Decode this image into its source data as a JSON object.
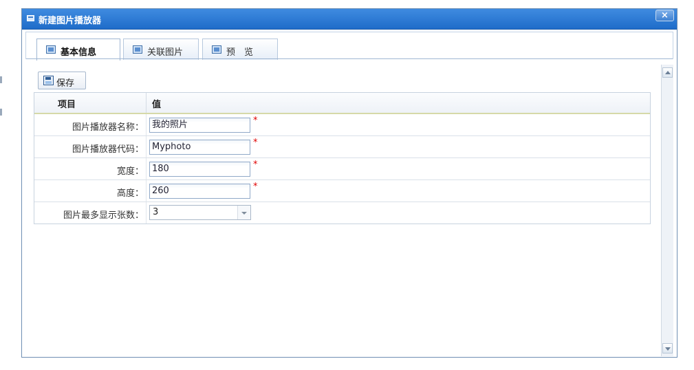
{
  "window": {
    "title": "新建图片播放器",
    "close_label": "×"
  },
  "tabs": [
    {
      "label": "基本信息",
      "active": true
    },
    {
      "label": "关联图片",
      "active": false
    },
    {
      "label": "预　览",
      "active": false
    }
  ],
  "toolbar": {
    "save_label": "保存"
  },
  "grid": {
    "headers": {
      "item": "项目",
      "value": "值"
    },
    "rows": [
      {
        "label": "图片播放器名称：",
        "value": "我的照片",
        "required": "*"
      },
      {
        "label": "图片播放器代码：",
        "value": "Myphoto",
        "required": "*"
      },
      {
        "label": "宽度：",
        "value": "180",
        "required": "*"
      },
      {
        "label": "高度：",
        "value": "260",
        "required": "*"
      },
      {
        "label": "图片最多显示张数：",
        "value": "3"
      }
    ]
  },
  "icons": {
    "title": "window-icon",
    "tab1": "form-icon",
    "tab2": "image-link-icon",
    "tab3": "preview-icon",
    "save": "save-icon"
  }
}
